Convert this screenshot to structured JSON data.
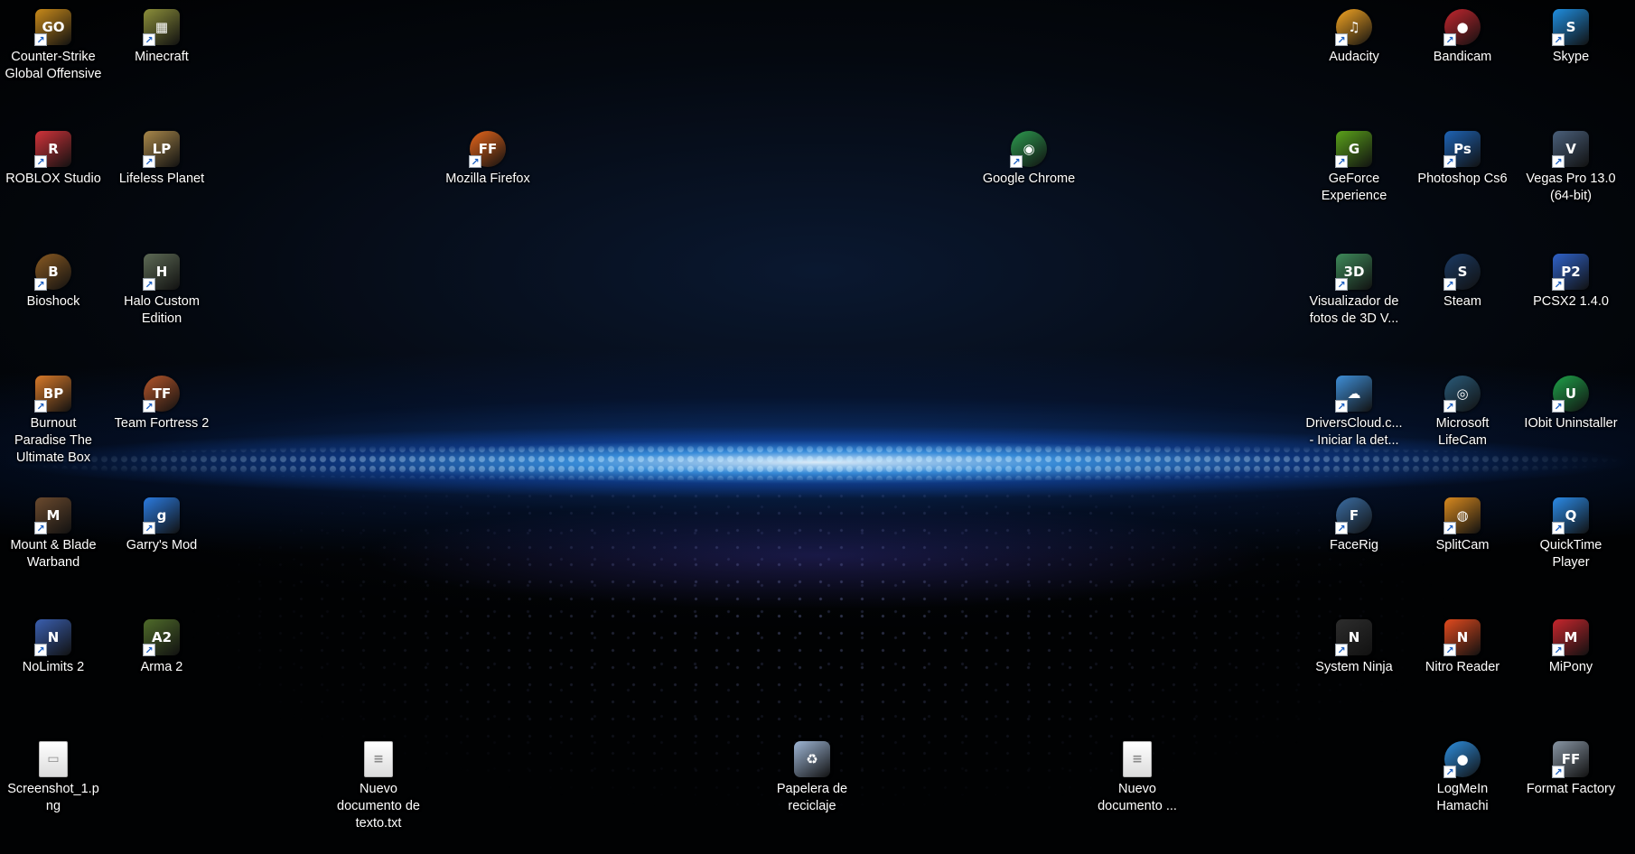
{
  "desktop": {
    "shortcut_glyph": "↗",
    "icons": [
      {
        "name": "counter-strike-icon",
        "label": "Counter-Strike Global Offensive",
        "glyph": "GO",
        "color": "#c98a1a"
      },
      {
        "name": "minecraft-icon",
        "label": "Minecraft",
        "glyph": "▦",
        "color": "#8c8f3a"
      },
      {
        "name": "roblox-studio-icon",
        "label": "ROBLOX Studio",
        "glyph": "R",
        "color": "#d2333a"
      },
      {
        "name": "lifeless-planet-icon",
        "label": "Lifeless Planet",
        "glyph": "LP",
        "color": "#a8874a"
      },
      {
        "name": "mozilla-firefox-icon",
        "label": "Mozilla Firefox",
        "glyph": "FF",
        "color": "#e8661b"
      },
      {
        "name": "google-chrome-icon",
        "label": "Google Chrome",
        "glyph": "◉",
        "color": "#2d9b4f"
      },
      {
        "name": "bioshock-icon",
        "label": "Bioshock",
        "glyph": "B",
        "color": "#8a5a22"
      },
      {
        "name": "halo-custom-edition-icon",
        "label": "Halo Custom Edition",
        "glyph": "H",
        "color": "#5d6a55"
      },
      {
        "name": "burnout-paradise-icon",
        "label": "Burnout Paradise The Ultimate Box",
        "glyph": "BP",
        "color": "#d97a2a"
      },
      {
        "name": "team-fortress-2-icon",
        "label": "Team Fortress 2",
        "glyph": "TF",
        "color": "#b5562b"
      },
      {
        "name": "mount-blade-warband-icon",
        "label": "Mount & Blade Warband",
        "glyph": "M",
        "color": "#6b4a2e"
      },
      {
        "name": "garrys-mod-icon",
        "label": "Garry's Mod",
        "glyph": "g",
        "color": "#2b7be0"
      },
      {
        "name": "nolimits-2-icon",
        "label": "NoLimits 2",
        "glyph": "N",
        "color": "#3a5fb0"
      },
      {
        "name": "arma-2-icon",
        "label": "Arma 2",
        "glyph": "A2",
        "color": "#4f6b2a"
      },
      {
        "name": "screenshot-file-icon",
        "label": "Screenshot_1.png",
        "glyph": "▭",
        "color": "#e9eef3"
      },
      {
        "name": "text-document-icon",
        "label": "Nuevo documento de texto.txt",
        "glyph": "≡",
        "color": "#ffffff"
      },
      {
        "name": "recycle-bin-icon",
        "label": "Papelera de reciclaje",
        "glyph": "♻",
        "color": "#9fb7d6"
      },
      {
        "name": "new-document-icon",
        "label": "Nuevo documento ...",
        "glyph": "≡",
        "color": "#ffffff"
      },
      {
        "name": "audacity-icon",
        "label": "Audacity",
        "glyph": "♫",
        "color": "#f5a623"
      },
      {
        "name": "bandicam-icon",
        "label": "Bandicam",
        "glyph": "●",
        "color": "#c4262e"
      },
      {
        "name": "skype-icon",
        "label": "Skype",
        "glyph": "S",
        "color": "#1f8ee0"
      },
      {
        "name": "geforce-experience-icon",
        "label": "GeForce Experience",
        "glyph": "G",
        "color": "#5aa21a"
      },
      {
        "name": "photoshop-icon",
        "label": "Photoshop Cs6",
        "glyph": "Ps",
        "color": "#1e63b5"
      },
      {
        "name": "vegas-pro-icon",
        "label": "Vegas Pro 13.0 (64-bit)",
        "glyph": "V",
        "color": "#4a5f7a"
      },
      {
        "name": "visualizador-3d-icon",
        "label": "Visualizador de fotos de 3D V...",
        "glyph": "3D",
        "color": "#3e8a5a"
      },
      {
        "name": "steam-icon",
        "label": "Steam",
        "glyph": "S",
        "color": "#1b3a63"
      },
      {
        "name": "pcsx2-icon",
        "label": "PCSX2 1.4.0",
        "glyph": "P2",
        "color": "#2f62c9"
      },
      {
        "name": "driverscloud-icon",
        "label": "DriversCloud.c... - Iniciar la det...",
        "glyph": "☁",
        "color": "#3f8fd8"
      },
      {
        "name": "microsoft-lifecam-icon",
        "label": "Microsoft LifeCam",
        "glyph": "◎",
        "color": "#2a5b7a"
      },
      {
        "name": "iobit-uninstaller-icon",
        "label": "IObit Uninstaller",
        "glyph": "U",
        "color": "#1fa34a"
      },
      {
        "name": "facerig-icon",
        "label": "FaceRig",
        "glyph": "F",
        "color": "#3b6ea5"
      },
      {
        "name": "splitcam-icon",
        "label": "SplitCam",
        "glyph": "◍",
        "color": "#d98a1f"
      },
      {
        "name": "quicktime-player-icon",
        "label": "QuickTime Player",
        "glyph": "Q",
        "color": "#2b8be8"
      },
      {
        "name": "system-ninja-icon",
        "label": "System Ninja",
        "glyph": "N",
        "color": "#2d2d2d"
      },
      {
        "name": "nitro-reader-icon",
        "label": "Nitro Reader",
        "glyph": "N",
        "color": "#e24a1e"
      },
      {
        "name": "mipony-icon",
        "label": "MiPony",
        "glyph": "M",
        "color": "#c8262d"
      },
      {
        "name": "logmein-hamachi-icon",
        "label": "LogMeIn Hamachi",
        "glyph": "●",
        "color": "#2e8fe0"
      },
      {
        "name": "format-factory-icon",
        "label": "Format Factory",
        "glyph": "FF",
        "color": "#8895a3"
      }
    ]
  }
}
